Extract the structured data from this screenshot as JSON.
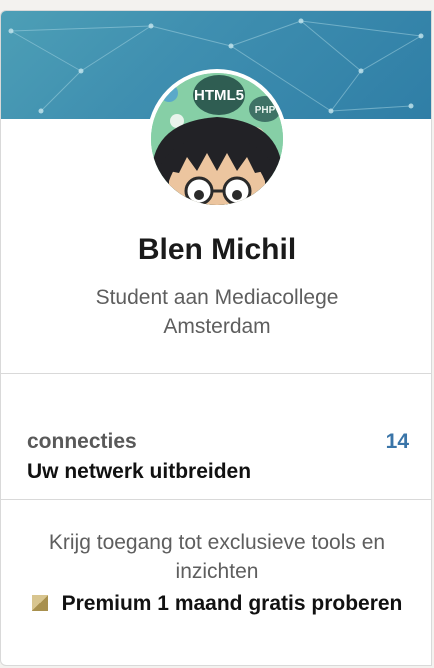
{
  "profile": {
    "name": "Blen Michil",
    "headline": "Student aan Mediacollege Amsterdam",
    "avatar_text_1": "HTML5",
    "avatar_text_2": "PHP"
  },
  "connections": {
    "label": "connecties",
    "count": "14",
    "link": "Uw netwerk uitbreiden"
  },
  "premium": {
    "text": "Krijg toegang tot exclusieve tools en inzichten",
    "link": "Premium 1 maand gratis proberen",
    "icon": "premium-gold-icon"
  },
  "colors": {
    "banner": "#3f8fb0",
    "count": "#3a75a8",
    "premium_gold": "#c9b27a"
  }
}
